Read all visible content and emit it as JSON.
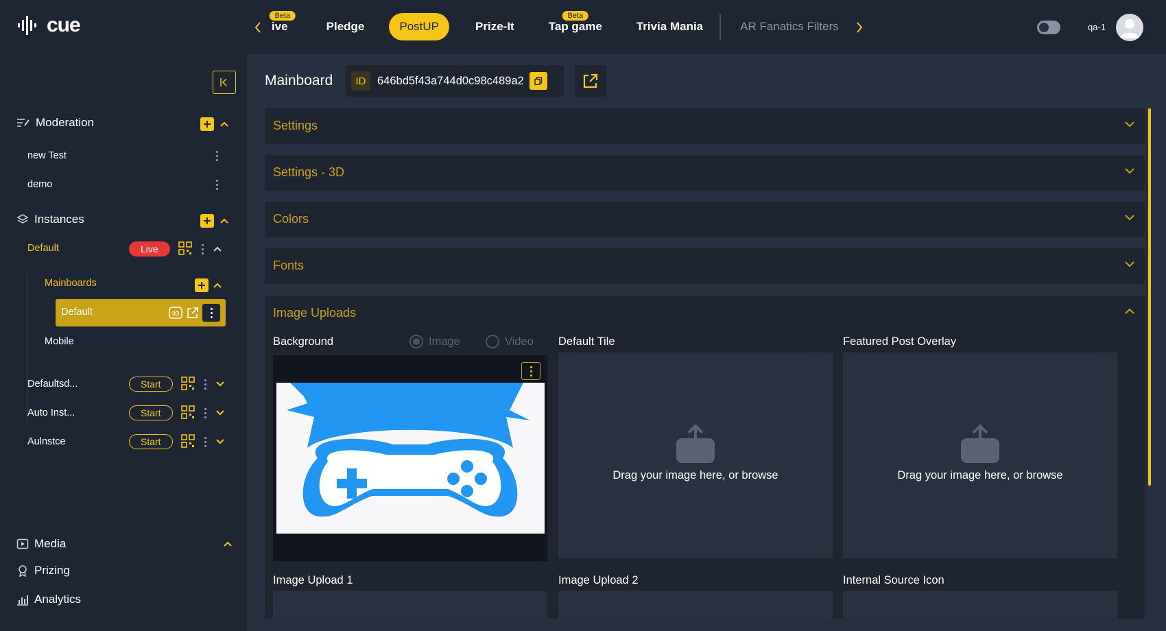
{
  "app": {
    "logo": "cue"
  },
  "nav": {
    "tabs": [
      {
        "label": "ive",
        "beta": "Beta"
      },
      {
        "label": "Pledge"
      },
      {
        "label": "PostUP",
        "active": true
      },
      {
        "label": "Prize-It"
      },
      {
        "label": "Tap game",
        "beta": "Beta"
      },
      {
        "label": "Trivia Mania"
      },
      {
        "label": "AR Fanatics Filters",
        "dim": true
      }
    ]
  },
  "user": {
    "name": "qa-1"
  },
  "sidebar": {
    "moderation": {
      "label": "Moderation",
      "items": [
        "new Test",
        "demo"
      ]
    },
    "instances": {
      "label": "Instances",
      "default": {
        "label": "Default",
        "status": "Live"
      },
      "mainboards": {
        "label": "Mainboards",
        "items": [
          "Default",
          "Mobile"
        ]
      },
      "others": [
        {
          "label": "Defaultsd...",
          "status": "Start"
        },
        {
          "label": "Auto Inst...",
          "status": "Start"
        },
        {
          "label": "Aulnstce",
          "status": "Start"
        }
      ]
    },
    "bottom": [
      "Media",
      "Prizing",
      "Analytics"
    ]
  },
  "main": {
    "title": "Mainboard",
    "id_tag": "ID",
    "id": "646bd5f43a744d0c98c489a2",
    "sections": [
      "Settings",
      "Settings - 3D",
      "Colors",
      "Fonts",
      "Image Uploads"
    ],
    "uploads": {
      "background": "Background",
      "radio_image": "Image",
      "radio_video": "Video",
      "default_tile": "Default Tile",
      "featured": "Featured Post Overlay",
      "drop_text": "Drag your image here, or browse",
      "upload1": "Image Upload 1",
      "upload2": "Image Upload 2",
      "internal": "Internal Source Icon"
    }
  },
  "colors": {
    "accent": "#f5c518",
    "live": "#e53935",
    "bg": "#1f2633",
    "panel": "#273040"
  }
}
